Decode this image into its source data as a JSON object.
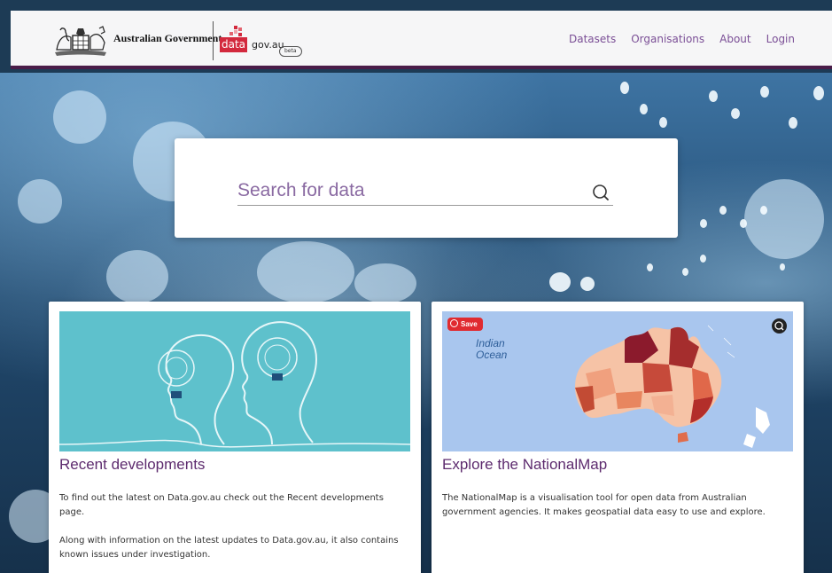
{
  "header": {
    "gov_name": "Australian Government",
    "site_prefix": "data",
    "site_domain": "gov.au",
    "beta_label": "beta",
    "nav": [
      "Datasets",
      "Organisations",
      "About",
      "Login"
    ]
  },
  "search": {
    "placeholder": "Search for data"
  },
  "cards": [
    {
      "title": "Recent developments",
      "paragraphs": [
        "To find out the latest on Data.gov.au check out the Recent developments page.",
        "Along with information on the latest updates to Data.gov.au, it also contains known issues under investigation."
      ]
    },
    {
      "title": "Explore the NationalMap",
      "save_label": "Save",
      "map_label": "Indian Ocean",
      "paragraphs": [
        "The NationalMap is a visualisation tool for open data from Australian government agencies. It makes geospatial data easy to use and explore."
      ]
    }
  ],
  "colors": {
    "accent_purple": "#5d2b6e",
    "header_border": "#4a1d49",
    "brand_red": "#d3293d",
    "nav_link": "#7b4f96"
  },
  "icons": [
    "coat-of-arms-icon",
    "search-icon",
    "save-pin-icon",
    "lens-icon"
  ]
}
